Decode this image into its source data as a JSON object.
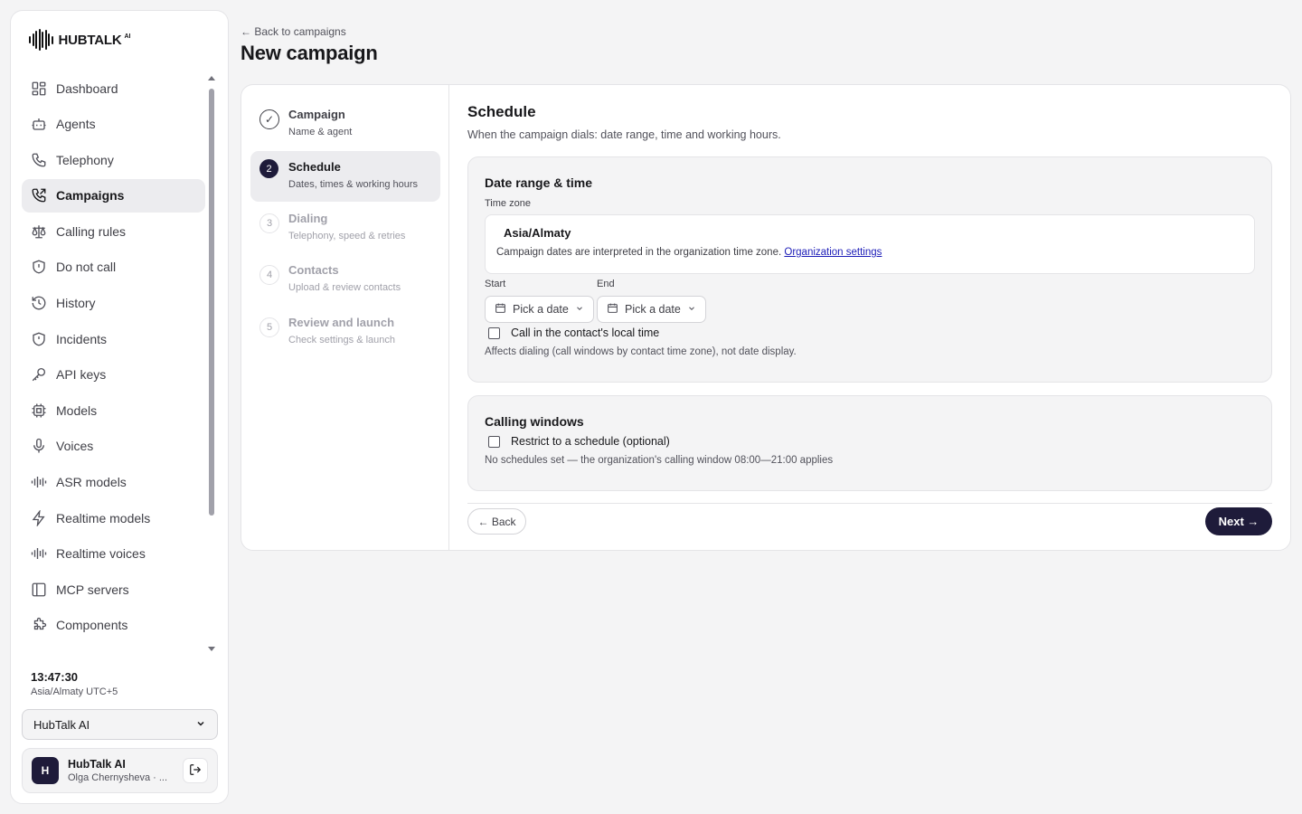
{
  "brand": {
    "name": "HUBTALK",
    "suffix": "AI"
  },
  "sidebar": {
    "items": [
      {
        "label": "Dashboard",
        "icon": "dashboard-icon"
      },
      {
        "label": "Agents",
        "icon": "bot-icon"
      },
      {
        "label": "Telephony",
        "icon": "phone-icon"
      },
      {
        "label": "Campaigns",
        "icon": "phone-outgoing-icon",
        "active": true
      },
      {
        "label": "Calling rules",
        "icon": "scale-icon"
      },
      {
        "label": "Do not call",
        "icon": "shield-icon"
      },
      {
        "label": "History",
        "icon": "history-icon"
      },
      {
        "label": "Incidents",
        "icon": "shield-alert-icon"
      },
      {
        "label": "API keys",
        "icon": "key-icon"
      },
      {
        "label": "Models",
        "icon": "cpu-icon"
      },
      {
        "label": "Voices",
        "icon": "mic-icon"
      },
      {
        "label": "ASR models",
        "icon": "audio-lines-icon"
      },
      {
        "label": "Realtime models",
        "icon": "zap-icon"
      },
      {
        "label": "Realtime voices",
        "icon": "audio-waveform-icon"
      },
      {
        "label": "MCP servers",
        "icon": "panel-icon"
      },
      {
        "label": "Components",
        "icon": "puzzle-icon"
      }
    ],
    "clock": "13:47:30",
    "timezone": "Asia/Almaty UTC+5",
    "org_select": "HubTalk AI",
    "user": {
      "initial": "H",
      "name": "HubTalk AI",
      "sub": "Olga Chernysheva · ..."
    }
  },
  "header": {
    "back": "← Back to campaigns",
    "title": "New campaign"
  },
  "steps": [
    {
      "num": "✓",
      "title": "Campaign",
      "sub": "Name & agent",
      "state": "done"
    },
    {
      "num": "2",
      "title": "Schedule",
      "sub": "Dates, times & working hours",
      "state": "current"
    },
    {
      "num": "3",
      "title": "Dialing",
      "sub": "Telephony, speed & retries",
      "state": "pending"
    },
    {
      "num": "4",
      "title": "Contacts",
      "sub": "Upload & review contacts",
      "state": "pending"
    },
    {
      "num": "5",
      "title": "Review and launch",
      "sub": "Check settings & launch",
      "state": "pending"
    }
  ],
  "schedule": {
    "title": "Schedule",
    "desc": "When the campaign dials: date range, time and working hours.",
    "date_range": {
      "title": "Date range & time",
      "tz_label": "Time zone",
      "tz_value": "Asia/Almaty",
      "tz_note": "Campaign dates are interpreted in the organization time zone.",
      "tz_link": "Organization settings",
      "start_label": "Start",
      "end_label": "End",
      "start_placeholder": "Pick a date",
      "end_placeholder": "Pick a date",
      "local_time_label": "Call in the contact's local time",
      "local_time_hint": "Affects dialing (call windows by contact time zone), not date display."
    },
    "calling_windows": {
      "title": "Calling windows",
      "restrict_label": "Restrict to a schedule (optional)",
      "hint": "No schedules set — the organization's calling window 08:00—21:00 applies"
    }
  },
  "footer": {
    "back": "← Back",
    "next": "Next →"
  },
  "colors": {
    "accent": "#1e1b3a",
    "link": "#1d1db8",
    "background": "#f4f4f5"
  }
}
